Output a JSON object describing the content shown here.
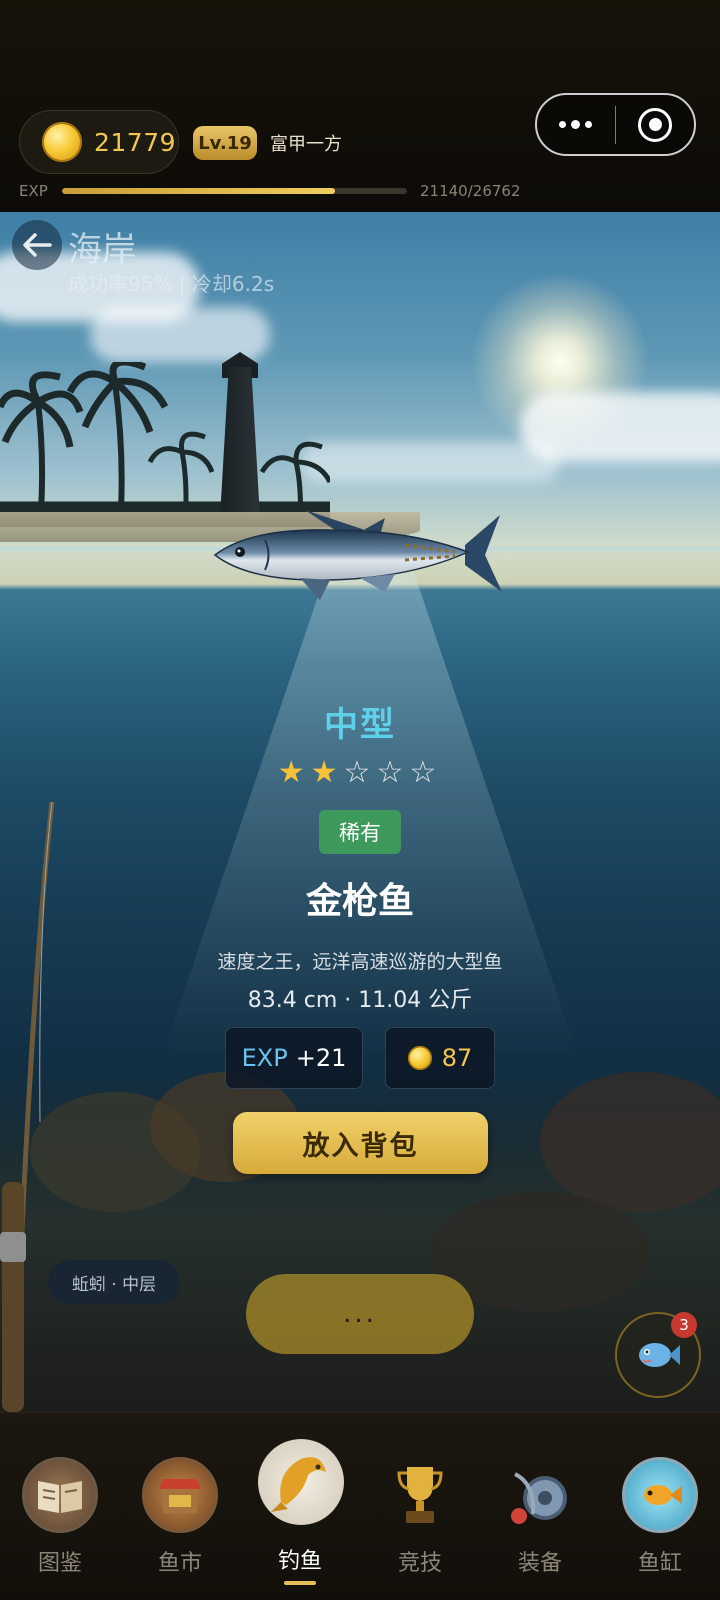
{
  "header": {
    "coins": "21779",
    "level": "Lv.19",
    "level_title": "富甲一方",
    "exp_label": "EXP",
    "exp_value": "21140/26762",
    "exp_progress": 0.79,
    "menu_icon": "more-dots-icon",
    "close_icon": "target-circle-icon"
  },
  "location": {
    "name": "海岸",
    "info": "成功率95% | 冷却6.2s",
    "back_icon": "back-arrow-icon"
  },
  "catch": {
    "size": "中型",
    "stars_filled": 2,
    "stars_total": 5,
    "rarity": "稀有",
    "name": "金枪鱼",
    "description": "速度之王，远洋高速巡游的大型鱼",
    "stats": "83.4 cm · 11.04 公斤",
    "exp_tag": "EXP",
    "exp_reward": "+21",
    "gold_reward": "87",
    "action_label": "放入背包"
  },
  "controls": {
    "bait": "蚯蚓 · 中层",
    "cast_label": "...",
    "tank_badge": "3"
  },
  "nav": {
    "items": [
      {
        "label": "图鉴",
        "icon": "book-icon"
      },
      {
        "label": "鱼市",
        "icon": "market-icon"
      },
      {
        "label": "钓鱼",
        "icon": "koi-fish-icon",
        "active": true
      },
      {
        "label": "竞技",
        "icon": "trophy-icon"
      },
      {
        "label": "装备",
        "icon": "reel-icon"
      },
      {
        "label": "鱼缸",
        "icon": "fishbowl-icon"
      }
    ]
  },
  "colors": {
    "accent_gold": "#f1c84f",
    "size_cyan": "#5fd0ea",
    "rarity_green": "#3e9a5c",
    "star_gold": "#f6c23a"
  }
}
